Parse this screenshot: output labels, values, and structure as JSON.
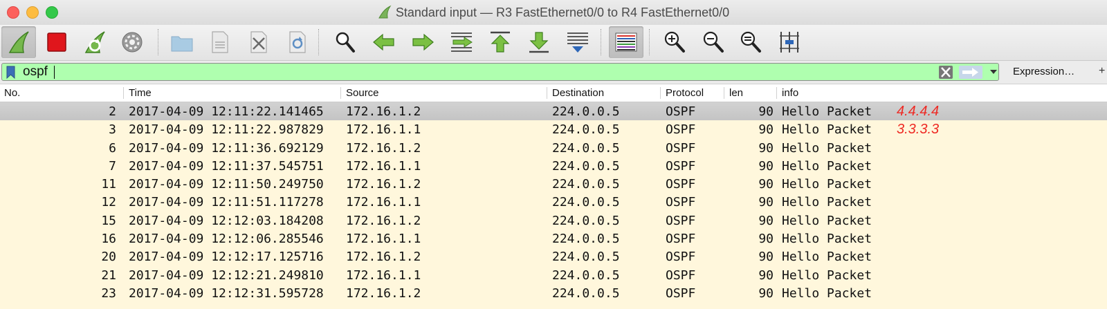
{
  "window": {
    "title": "Standard input — R3 FastEthernet0/0 to R4 FastEthernet0/0"
  },
  "toolbar": {
    "buttons": [
      {
        "name": "start-capture",
        "icon": "shark-fin-icon"
      },
      {
        "name": "stop-capture",
        "icon": "stop-square-icon"
      },
      {
        "name": "restart-capture",
        "icon": "restart-fin-icon"
      },
      {
        "name": "capture-options",
        "icon": "gear-icon"
      },
      {
        "name": "open-file",
        "icon": "folder-icon"
      },
      {
        "name": "save-file",
        "icon": "file-icon"
      },
      {
        "name": "close-file",
        "icon": "close-file-icon"
      },
      {
        "name": "reload-file",
        "icon": "reload-file-icon"
      },
      {
        "name": "find-packet",
        "icon": "magnifier-icon"
      },
      {
        "name": "go-back",
        "icon": "arrow-left-icon"
      },
      {
        "name": "go-forward",
        "icon": "arrow-right-icon"
      },
      {
        "name": "go-to-packet",
        "icon": "goto-packet-icon"
      },
      {
        "name": "go-first",
        "icon": "arrow-up-top-icon"
      },
      {
        "name": "go-last",
        "icon": "arrow-down-bottom-icon"
      },
      {
        "name": "auto-scroll",
        "icon": "autoscroll-icon"
      },
      {
        "name": "colorize",
        "icon": "colorize-lines-icon"
      },
      {
        "name": "zoom-in",
        "icon": "zoom-in-icon"
      },
      {
        "name": "zoom-out",
        "icon": "zoom-out-icon"
      },
      {
        "name": "zoom-normal",
        "icon": "zoom-normal-icon"
      },
      {
        "name": "resize-columns",
        "icon": "resize-columns-icon"
      }
    ]
  },
  "filter": {
    "value": "ospf",
    "expression_label": "Expression…",
    "plus_label": "+",
    "background": "#afffaf"
  },
  "columns": [
    "No.",
    "Time",
    "Source",
    "Destination",
    "Protocol",
    "len",
    "info"
  ],
  "packets": [
    {
      "no": "2",
      "time": "2017-04-09 12:11:22.141465",
      "source": "172.16.1.2",
      "destination": "224.0.0.5",
      "protocol": "OSPF",
      "len": "90",
      "info": "Hello Packet",
      "annotation": "4.4.4.4",
      "selected": true
    },
    {
      "no": "3",
      "time": "2017-04-09 12:11:22.987829",
      "source": "172.16.1.1",
      "destination": "224.0.0.5",
      "protocol": "OSPF",
      "len": "90",
      "info": "Hello Packet",
      "annotation": "3.3.3.3"
    },
    {
      "no": "6",
      "time": "2017-04-09 12:11:36.692129",
      "source": "172.16.1.2",
      "destination": "224.0.0.5",
      "protocol": "OSPF",
      "len": "90",
      "info": "Hello Packet"
    },
    {
      "no": "7",
      "time": "2017-04-09 12:11:37.545751",
      "source": "172.16.1.1",
      "destination": "224.0.0.5",
      "protocol": "OSPF",
      "len": "90",
      "info": "Hello Packet"
    },
    {
      "no": "11",
      "time": "2017-04-09 12:11:50.249750",
      "source": "172.16.1.2",
      "destination": "224.0.0.5",
      "protocol": "OSPF",
      "len": "90",
      "info": "Hello Packet"
    },
    {
      "no": "12",
      "time": "2017-04-09 12:11:51.117278",
      "source": "172.16.1.1",
      "destination": "224.0.0.5",
      "protocol": "OSPF",
      "len": "90",
      "info": "Hello Packet"
    },
    {
      "no": "15",
      "time": "2017-04-09 12:12:03.184208",
      "source": "172.16.1.2",
      "destination": "224.0.0.5",
      "protocol": "OSPF",
      "len": "90",
      "info": "Hello Packet"
    },
    {
      "no": "16",
      "time": "2017-04-09 12:12:06.285546",
      "source": "172.16.1.1",
      "destination": "224.0.0.5",
      "protocol": "OSPF",
      "len": "90",
      "info": "Hello Packet"
    },
    {
      "no": "20",
      "time": "2017-04-09 12:12:17.125716",
      "source": "172.16.1.2",
      "destination": "224.0.0.5",
      "protocol": "OSPF",
      "len": "90",
      "info": "Hello Packet"
    },
    {
      "no": "21",
      "time": "2017-04-09 12:12:21.249810",
      "source": "172.16.1.1",
      "destination": "224.0.0.5",
      "protocol": "OSPF",
      "len": "90",
      "info": "Hello Packet"
    },
    {
      "no": "23",
      "time": "2017-04-09 12:12:31.595728",
      "source": "172.16.1.2",
      "destination": "224.0.0.5",
      "protocol": "OSPF",
      "len": "90",
      "info": "Hello Packet"
    }
  ],
  "colors": {
    "row_background": "#fff7dc",
    "selected_row": "#c8c8c8",
    "annotation": "#ee2a24"
  }
}
